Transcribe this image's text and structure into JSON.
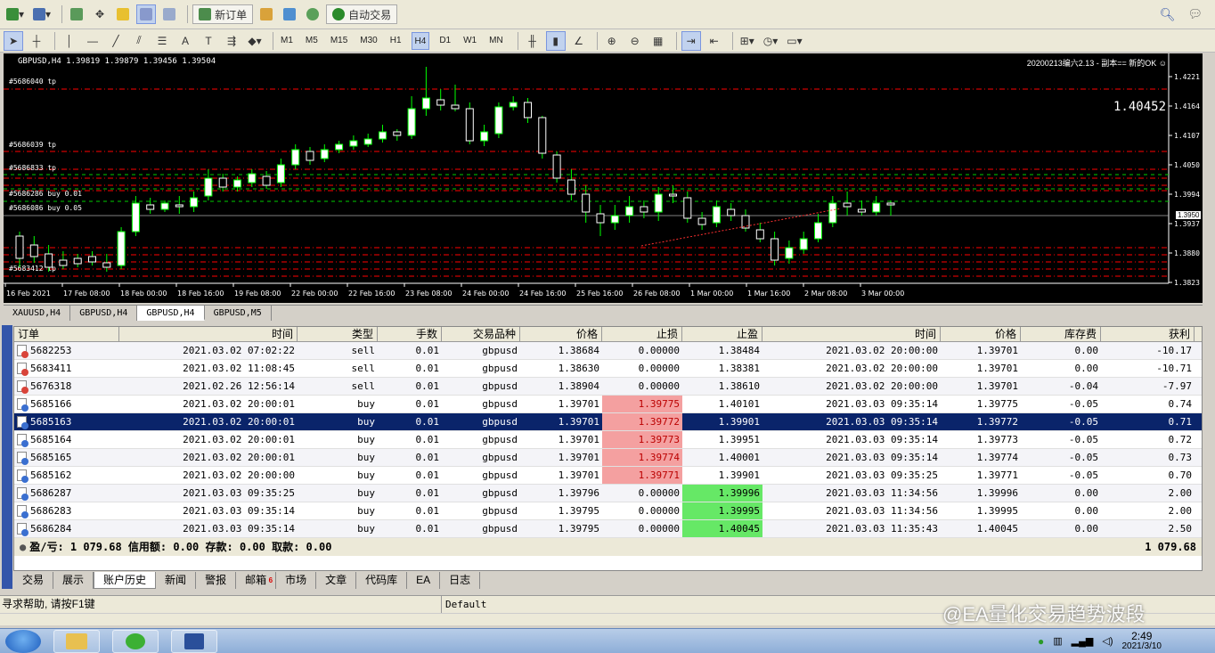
{
  "toolbar": {
    "new_order": "新订单",
    "auto_trading": "自动交易"
  },
  "timeframes": [
    "M1",
    "M5",
    "M15",
    "M30",
    "H1",
    "H4",
    "D1",
    "W1",
    "MN"
  ],
  "active_timeframe": "H4",
  "chart": {
    "title": "GBPUSD,H4  1.39819 1.39879 1.39456 1.39504",
    "note": "20200213编六2.13 - 副本== 新的OK ☺",
    "big_price": "1.40452",
    "current_price": "1.3950",
    "price_ticks": [
      "1.4221",
      "1.4164",
      "1.4107",
      "1.4050",
      "1.3994",
      "1.3937",
      "1.3880",
      "1.3823"
    ],
    "time_ticks": [
      "16 Feb 2021",
      "17 Feb 08:00",
      "18 Feb 00:00",
      "18 Feb 16:00",
      "19 Feb 08:00",
      "22 Feb 00:00",
      "22 Feb 16:00",
      "23 Feb 08:00",
      "24 Feb 00:00",
      "24 Feb 16:00",
      "25 Feb 16:00",
      "26 Feb 08:00",
      "1 Mar 00:00",
      "1 Mar 16:00",
      "2 Mar 08:00",
      "3 Mar 00:00"
    ],
    "line_labels": [
      "#5686040 tp",
      "#5686039 tp",
      "#5686833 tp",
      "#5686286 buy 0.01",
      "#5686086 buy 0.05",
      "#5683412 tp"
    ],
    "colors": {
      "up": "#ffffff",
      "down": "#ffffff",
      "wick": "#00ff00",
      "level": "#ff0000",
      "tp": "#00cc00"
    }
  },
  "chart_tabs": [
    "XAUUSD,H4",
    "GBPUSD,H4",
    "GBPUSD,H4",
    "GBPUSD,M5"
  ],
  "active_chart_tab": 2,
  "terminal": {
    "headers": [
      "订单",
      "时间",
      "类型",
      "手数",
      "交易品种",
      "价格",
      "止损",
      "止盈",
      "时间",
      "价格",
      "库存费",
      "获利"
    ],
    "rows": [
      [
        "5682253",
        "2021.03.02 07:02:22",
        "sell",
        "0.01",
        "gbpusd",
        "1.38684",
        "0.00000",
        "1.38484",
        "2021.03.02 20:00:00",
        "1.39701",
        "0.00",
        "-10.17"
      ],
      [
        "5683411",
        "2021.03.02 11:08:45",
        "sell",
        "0.01",
        "gbpusd",
        "1.38630",
        "0.00000",
        "1.38381",
        "2021.03.02 20:00:00",
        "1.39701",
        "0.00",
        "-10.71"
      ],
      [
        "5676318",
        "2021.02.26 12:56:14",
        "sell",
        "0.01",
        "gbpusd",
        "1.38904",
        "0.00000",
        "1.38610",
        "2021.03.02 20:00:00",
        "1.39701",
        "-0.04",
        "-7.97"
      ],
      [
        "5685166",
        "2021.03.02 20:00:01",
        "buy",
        "0.01",
        "gbpusd",
        "1.39701",
        "1.39775",
        "1.40101",
        "2021.03.03 09:35:14",
        "1.39775",
        "-0.05",
        "0.74"
      ],
      [
        "5685163",
        "2021.03.02 20:00:01",
        "buy",
        "0.01",
        "gbpusd",
        "1.39701",
        "1.39772",
        "1.39901",
        "2021.03.03 09:35:14",
        "1.39772",
        "-0.05",
        "0.71"
      ],
      [
        "5685164",
        "2021.03.02 20:00:01",
        "buy",
        "0.01",
        "gbpusd",
        "1.39701",
        "1.39773",
        "1.39951",
        "2021.03.03 09:35:14",
        "1.39773",
        "-0.05",
        "0.72"
      ],
      [
        "5685165",
        "2021.03.02 20:00:01",
        "buy",
        "0.01",
        "gbpusd",
        "1.39701",
        "1.39774",
        "1.40001",
        "2021.03.03 09:35:14",
        "1.39774",
        "-0.05",
        "0.73"
      ],
      [
        "5685162",
        "2021.03.02 20:00:00",
        "buy",
        "0.01",
        "gbpusd",
        "1.39701",
        "1.39771",
        "1.39901",
        "2021.03.03 09:35:25",
        "1.39771",
        "-0.05",
        "0.70"
      ],
      [
        "5686287",
        "2021.03.03 09:35:25",
        "buy",
        "0.01",
        "gbpusd",
        "1.39796",
        "0.00000",
        "1.39996",
        "2021.03.03 11:34:56",
        "1.39996",
        "0.00",
        "2.00"
      ],
      [
        "5686283",
        "2021.03.03 09:35:14",
        "buy",
        "0.01",
        "gbpusd",
        "1.39795",
        "0.00000",
        "1.39995",
        "2021.03.03 11:34:56",
        "1.39995",
        "0.00",
        "2.00"
      ],
      [
        "5686284",
        "2021.03.03 09:35:14",
        "buy",
        "0.01",
        "gbpusd",
        "1.39795",
        "0.00000",
        "1.40045",
        "2021.03.03 11:35:43",
        "1.40045",
        "0.00",
        "2.50"
      ]
    ],
    "selected_row": 4,
    "summary": "盈/亏: 1 079.68  信用额: 0.00  存款: 0.00  取款: 0.00",
    "total": "1 079.68"
  },
  "terminal_tabs": [
    "交易",
    "展示",
    "账户历史",
    "新闻",
    "警报",
    "邮箱",
    "市场",
    "文章",
    "代码库",
    "EA",
    "日志"
  ],
  "active_terminal_tab": 2,
  "mail_badge": "6",
  "status": {
    "help": "寻求帮助, 请按F1键",
    "profile": "Default"
  },
  "taskbar": {
    "time": "2:49",
    "date": "2021/3/10"
  },
  "watermark": "@EA量化交易趋势波段"
}
